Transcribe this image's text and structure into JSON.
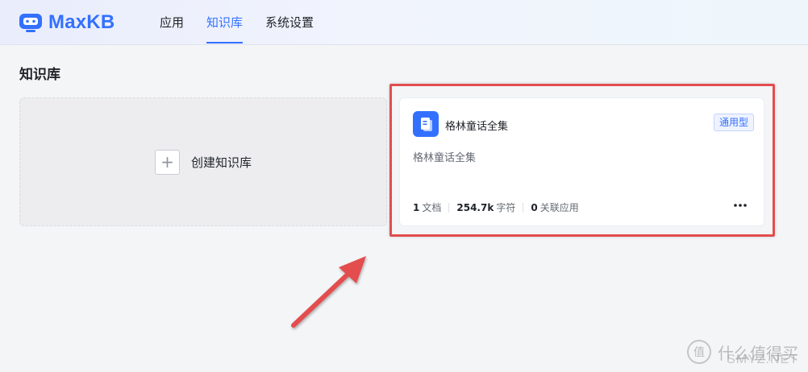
{
  "app": {
    "brand": "MaxKB",
    "logo_icon": "robot-logo-icon",
    "accent": "#3370ff"
  },
  "nav": {
    "items": [
      {
        "label": "应用",
        "active": false
      },
      {
        "label": "知识库",
        "active": true
      },
      {
        "label": "系统设置",
        "active": false
      }
    ]
  },
  "page": {
    "title": "知识库"
  },
  "create_card": {
    "label": "创建知识库",
    "icon": "plus-icon"
  },
  "knowledge_bases": [
    {
      "name": "格林童话全集",
      "badge": "通用型",
      "description": "格林童话全集",
      "icon": "document-icon",
      "stats": {
        "doc_count": "1",
        "doc_label": "文档",
        "char_count": "254.7k",
        "char_label": "字符",
        "app_count": "0",
        "app_label": "关联应用"
      }
    }
  ],
  "annotation": {
    "highlight_color": "#e34d4d"
  },
  "watermark": {
    "mark": "值",
    "text": "什么值得买",
    "sub": "SMYZ.NET"
  }
}
